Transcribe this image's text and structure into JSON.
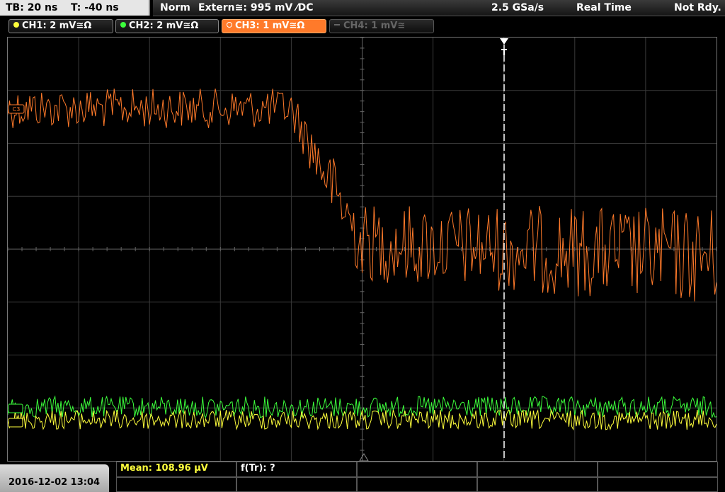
{
  "topbar": {
    "timebase": "TB: 20 ns",
    "trigger_pos": "T: -40 ns",
    "mode": "Norm",
    "trigger_source": "Extern≅: 995 mV ⁄DC",
    "sample_rate": "2.5 GSa/s",
    "acq_mode": "Real Time",
    "status": "Not Rdy."
  },
  "channels": [
    {
      "label": "CH1: 2 mV≅Ω",
      "color": "#ffff3c",
      "state": "on"
    },
    {
      "label": "CH2: 2 mV≅Ω",
      "color": "#3cff3c",
      "state": "on"
    },
    {
      "label": "CH3: 1 mV≅Ω",
      "color": "#ff7a2a",
      "state": "active"
    },
    {
      "label": "CH4: 1 mV≅",
      "color": "#666666",
      "state": "off"
    }
  ],
  "markers": {
    "ch3_marker": "C3",
    "trigger_marker": "T"
  },
  "measurements": {
    "mean": "Mean: 108.96 μV",
    "ftr": "f(Tr): ?"
  },
  "datetime": "2016-12-02 13:04",
  "colors": {
    "ch1": "#ffff3c",
    "ch2": "#3cff3c",
    "ch3": "#ff7a2a",
    "grid": "#555555"
  }
}
